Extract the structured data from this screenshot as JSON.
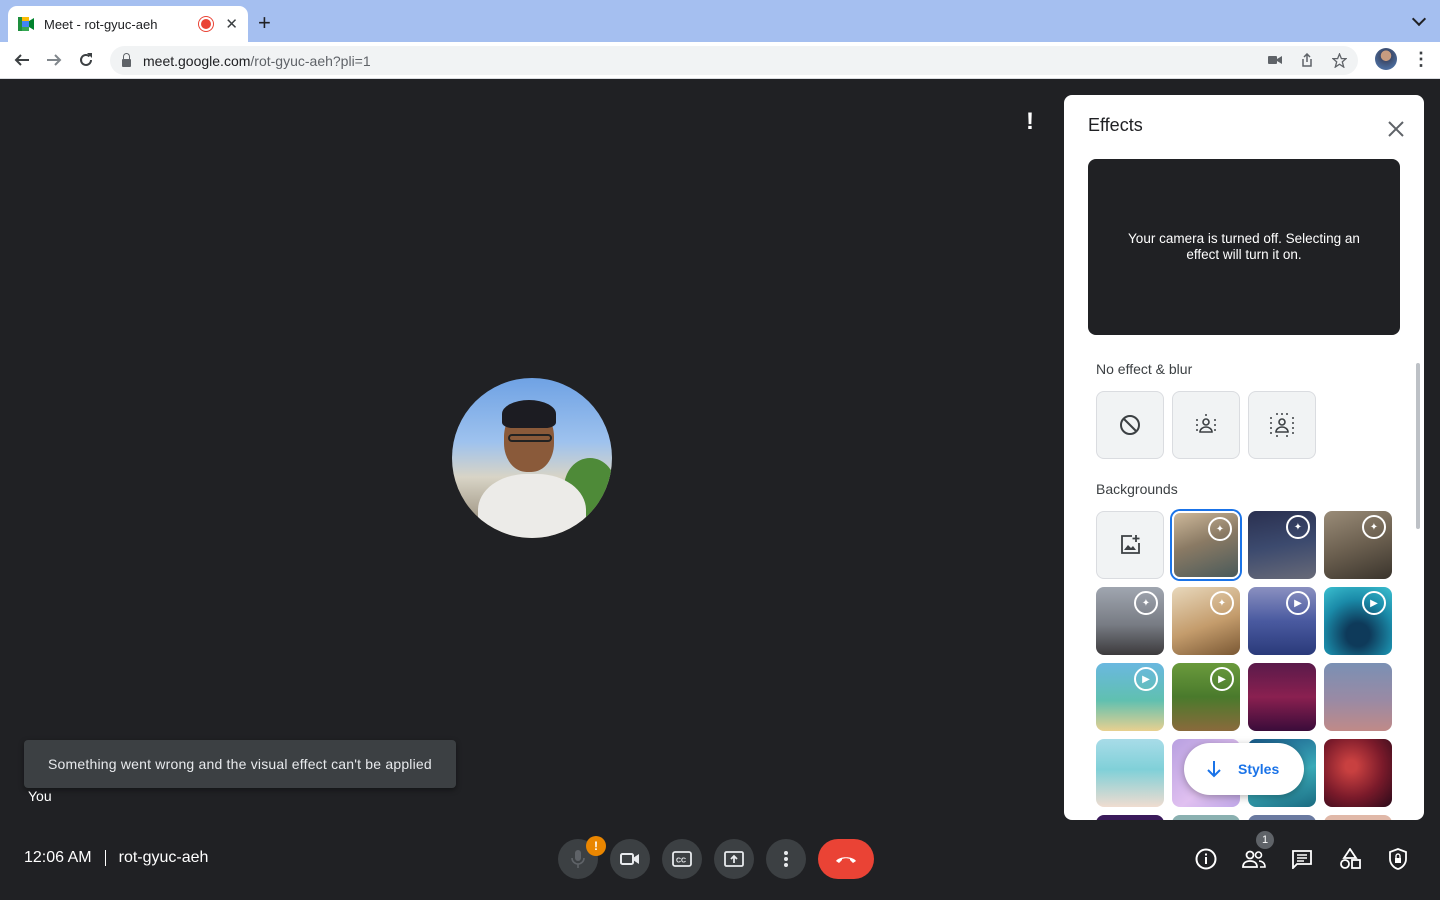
{
  "browser": {
    "tab_title": "Meet - rot-gyuc-aeh",
    "url_host": "meet.google.com",
    "url_path": "/rot-gyuc-aeh?pli=1"
  },
  "meeting": {
    "time": "12:06 AM",
    "code": "rot-gyuc-aeh",
    "self_label": "You",
    "snackbar": "Something went wrong and the visual effect can't be applied",
    "participant_count": "1"
  },
  "controls": {
    "mic_warning": "!",
    "colors": {
      "end_call": "#ea4335",
      "warning": "#ea8600",
      "accent": "#1a73e8"
    }
  },
  "effects_panel": {
    "title": "Effects",
    "preview_text": "Your camera is turned off. Selecting an effect will turn it on.",
    "section_no_effect": "No effect & blur",
    "section_backgrounds": "Backgrounds",
    "styles_button": "Styles",
    "no_effect_tiles": [
      "no-effect",
      "slight-blur",
      "blur"
    ],
    "background_tiles": [
      {
        "name": "upload-background",
        "kind": "upload"
      },
      {
        "name": "bg-living-room",
        "kind": "animated",
        "selected": true
      },
      {
        "name": "bg-night-city",
        "kind": "animated"
      },
      {
        "name": "bg-bookshelf",
        "kind": "animated"
      },
      {
        "name": "bg-window-desk",
        "kind": "animated"
      },
      {
        "name": "bg-warm-room",
        "kind": "animated"
      },
      {
        "name": "bg-space-chair",
        "kind": "animated"
      },
      {
        "name": "bg-underwater",
        "kind": "animated"
      },
      {
        "name": "bg-beach-cartoon",
        "kind": "animated"
      },
      {
        "name": "bg-forest-cartoon",
        "kind": "animated"
      },
      {
        "name": "bg-theater",
        "kind": "still"
      },
      {
        "name": "bg-sunset-gradient",
        "kind": "still"
      },
      {
        "name": "bg-beach",
        "kind": "still"
      },
      {
        "name": "bg-purple-haze",
        "kind": "still"
      },
      {
        "name": "bg-teal-abstract",
        "kind": "still"
      },
      {
        "name": "bg-red-nebula",
        "kind": "still"
      }
    ]
  }
}
